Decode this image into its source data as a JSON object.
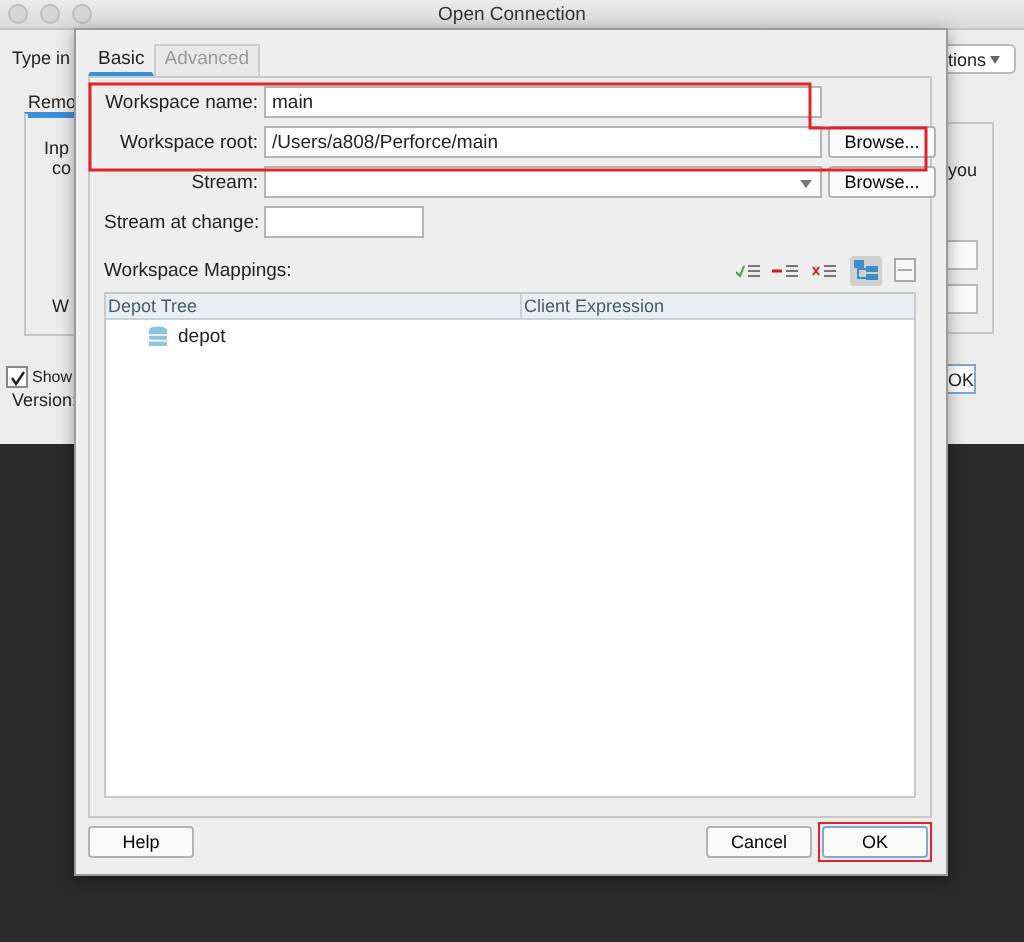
{
  "back_window": {
    "title": "Open Connection",
    "left_texts": [
      {
        "kind": "label",
        "text": "Type in"
      },
      {
        "kind": "tab",
        "text": "Remo"
      },
      {
        "kind": "panel_text",
        "text": "Inp"
      },
      {
        "kind": "panel_text",
        "text": "co"
      },
      {
        "kind": "panel_text",
        "text": "W"
      },
      {
        "kind": "checkbox",
        "text": "Show",
        "checked": true
      },
      {
        "kind": "label",
        "text": "Version:"
      }
    ],
    "right_texts": [
      {
        "kind": "menu_button",
        "text": "tions"
      },
      {
        "kind": "panel_text",
        "text": "you"
      },
      {
        "kind": "button",
        "text": "OK"
      }
    ]
  },
  "dialog": {
    "tabs": [
      {
        "label": "Basic",
        "selected": true
      },
      {
        "label": "Advanced",
        "selected": false
      }
    ],
    "fields": [
      {
        "kind": "text",
        "label": "Workspace name:",
        "value": "main"
      },
      {
        "kind": "browse",
        "label": "Workspace root:",
        "value": "/Users/a808/Perforce/main",
        "button": "Browse..."
      },
      {
        "kind": "combo",
        "label": "Stream:",
        "button": "Browse..."
      },
      {
        "kind": "short",
        "label": "Stream at change:"
      }
    ],
    "highlight_workspace_fields": true,
    "mappings_label": "Workspace Mappings:",
    "tree_view_selected": true,
    "table": {
      "columns": [
        "Depot Tree",
        "Client Expression"
      ],
      "rows": [
        {
          "name": "depot"
        }
      ]
    },
    "buttons": [
      {
        "label": "Help",
        "highlighted": false
      },
      {
        "label": "Cancel",
        "highlighted": false
      },
      {
        "label": "OK",
        "highlighted": true
      }
    ]
  }
}
